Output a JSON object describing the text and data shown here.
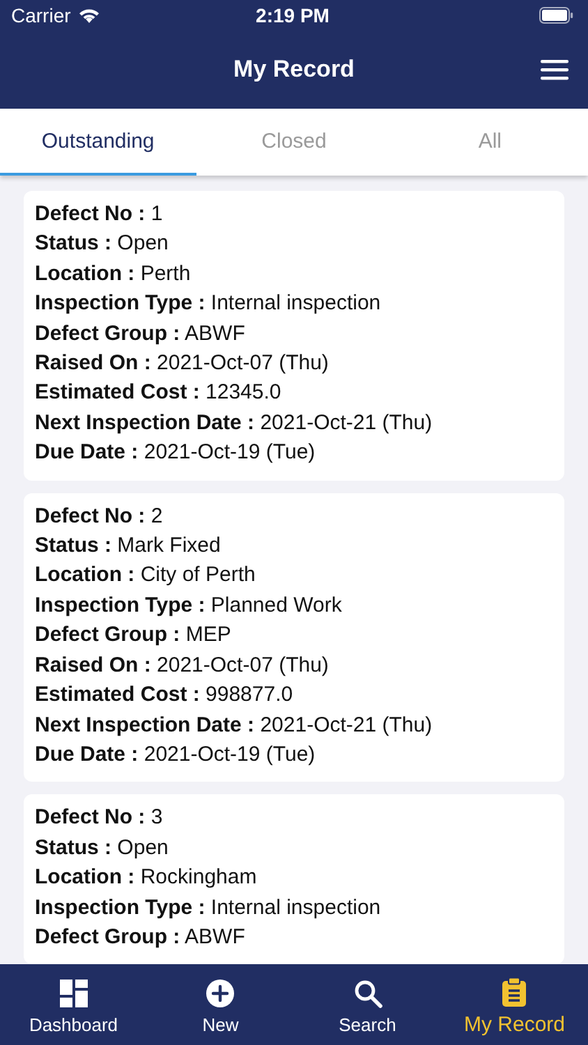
{
  "status_bar": {
    "carrier": "Carrier",
    "time": "2:19 PM"
  },
  "header": {
    "title": "My Record"
  },
  "tabs": [
    {
      "label": "Outstanding",
      "selected": true
    },
    {
      "label": "Closed",
      "selected": false
    },
    {
      "label": "All",
      "selected": false
    }
  ],
  "records": [
    {
      "fields": [
        "**Defect No :** 1",
        "**Status :** Open",
        "**Location :** Perth",
        "**Inspection Type :** Internal inspection",
        "**Defect Group :** ABWF",
        "**Raised On :** 2021-Oct-07 (Thu)",
        "**Estimated Cost :** 12345.0",
        "**Next Inspection Date :** 2021-Oct-21 (Thu)",
        "**Due Date :** 2021-Oct-19 (Tue)"
      ]
    },
    {
      "fields": [
        "**Defect No :** 2",
        "**Status :** Mark Fixed",
        "**Location :** City of Perth",
        "**Inspection Type :** Planned Work",
        "**Defect Group :** MEP",
        "**Raised On :** 2021-Oct-07 (Thu)",
        "**Estimated Cost :** 998877.0",
        "**Next Inspection Date :** 2021-Oct-21 (Thu)",
        "**Due Date :** 2021-Oct-19 (Tue)"
      ]
    },
    {
      "fields": [
        "**Defect No :** 3",
        "**Status :** Open",
        "**Location :** Rockingham",
        "**Inspection Type :** Internal inspection",
        "**Defect Group :** ABWF"
      ]
    }
  ],
  "nav": [
    {
      "kind": "dashboard",
      "label": "Dashboard",
      "selected": false
    },
    {
      "kind": "new",
      "label": "New",
      "selected": false
    },
    {
      "kind": "search",
      "label": "Search",
      "selected": false
    },
    {
      "kind": "record",
      "label": "My Record",
      "selected": true
    }
  ]
}
